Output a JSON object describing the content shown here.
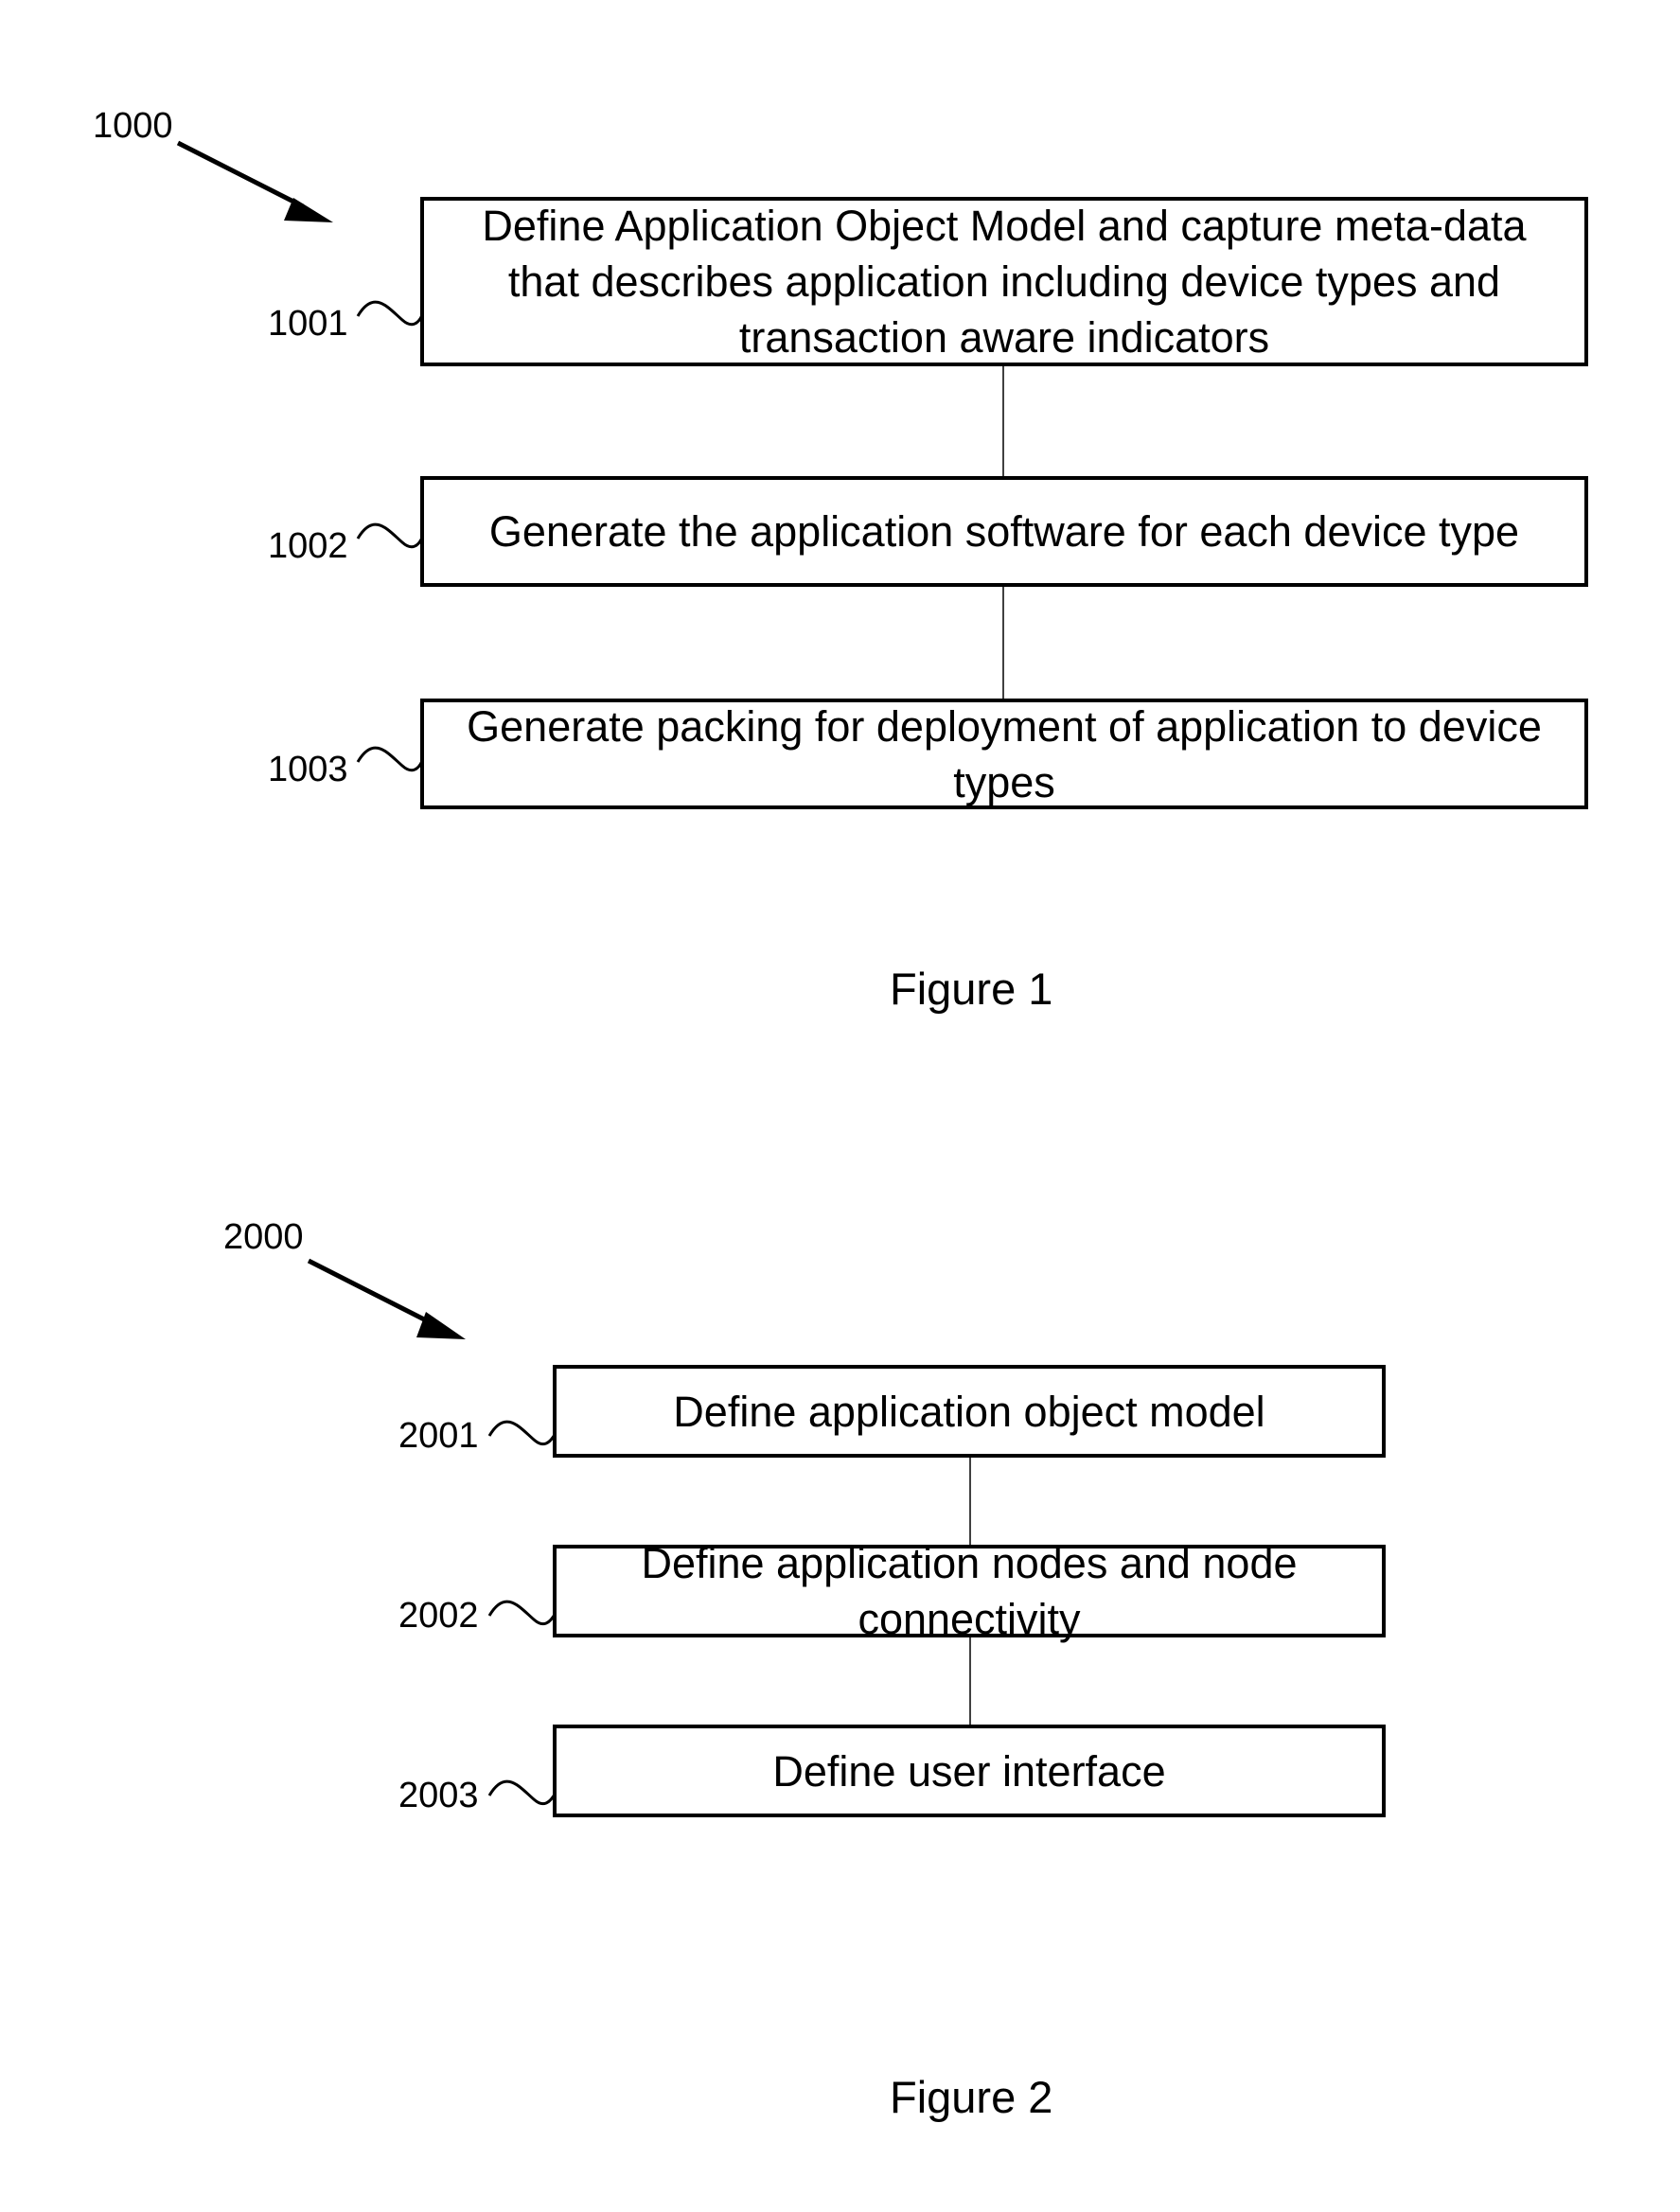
{
  "figures": [
    {
      "caption": "Figure 1",
      "ref": "1000",
      "steps": [
        {
          "ref": "1001",
          "text": "Define Application Object Model and capture meta-data that describes application including device types and transaction aware indicators"
        },
        {
          "ref": "1002",
          "text": "Generate the application software for each device type"
        },
        {
          "ref": "1003",
          "text": "Generate packing for deployment of application to device types"
        }
      ]
    },
    {
      "caption": "Figure 2",
      "ref": "2000",
      "steps": [
        {
          "ref": "2001",
          "text": "Define application object model"
        },
        {
          "ref": "2002",
          "text": "Define application nodes and node connectivity"
        },
        {
          "ref": "2003",
          "text": "Define user interface"
        }
      ]
    }
  ]
}
